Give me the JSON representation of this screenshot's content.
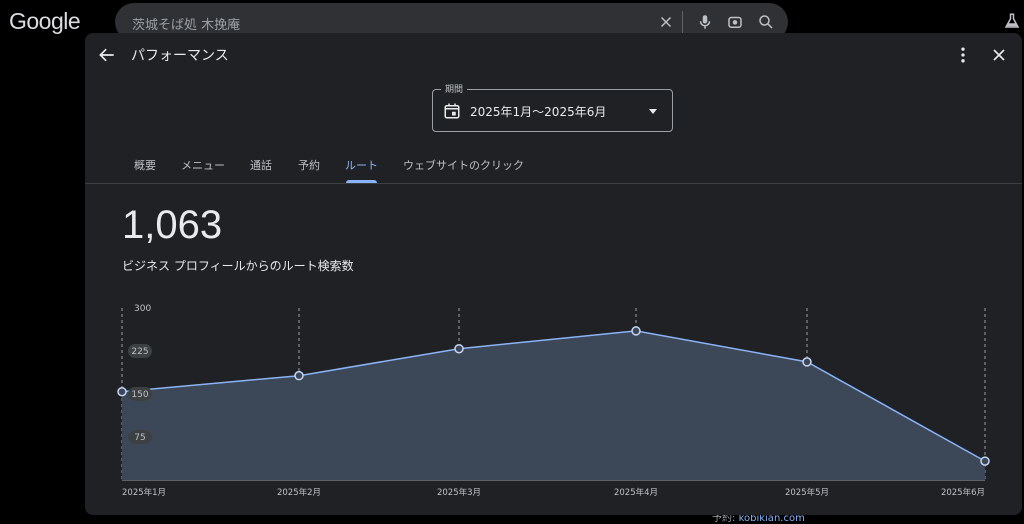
{
  "google": {
    "logo_text": "Google"
  },
  "search": {
    "query": "茨城そば処 木挽庵"
  },
  "below_text": {
    "label": "予約:",
    "link": "kobikian.com"
  },
  "dialog": {
    "title": "パフォーマンス",
    "period": {
      "label": "期間",
      "value": "2025年1月〜2025年6月"
    },
    "tabs": [
      {
        "label": "概要",
        "active": false
      },
      {
        "label": "メニュー",
        "active": false
      },
      {
        "label": "通話",
        "active": false
      },
      {
        "label": "予約",
        "active": false
      },
      {
        "label": "ルート",
        "active": true
      },
      {
        "label": "ウェブサイトのクリック",
        "active": false
      }
    ],
    "metric": {
      "value": "1,063",
      "description": "ビジネス プロフィールからのルート検索数"
    }
  },
  "colors": {
    "accent": "#8ab4f8",
    "area_fill": "#3c4758",
    "background": "#202124"
  },
  "chart_data": {
    "type": "area",
    "categories": [
      "2025年1月",
      "2025年2月",
      "2025年3月",
      "2025年4月",
      "2025年5月",
      "2025年6月"
    ],
    "values": [
      154,
      182,
      229,
      260,
      206,
      33
    ],
    "yticks": [
      75,
      150,
      225,
      300
    ],
    "ylim": [
      0,
      300
    ],
    "grid": "vertical dashed",
    "title": "",
    "xlabel": "",
    "ylabel": ""
  }
}
